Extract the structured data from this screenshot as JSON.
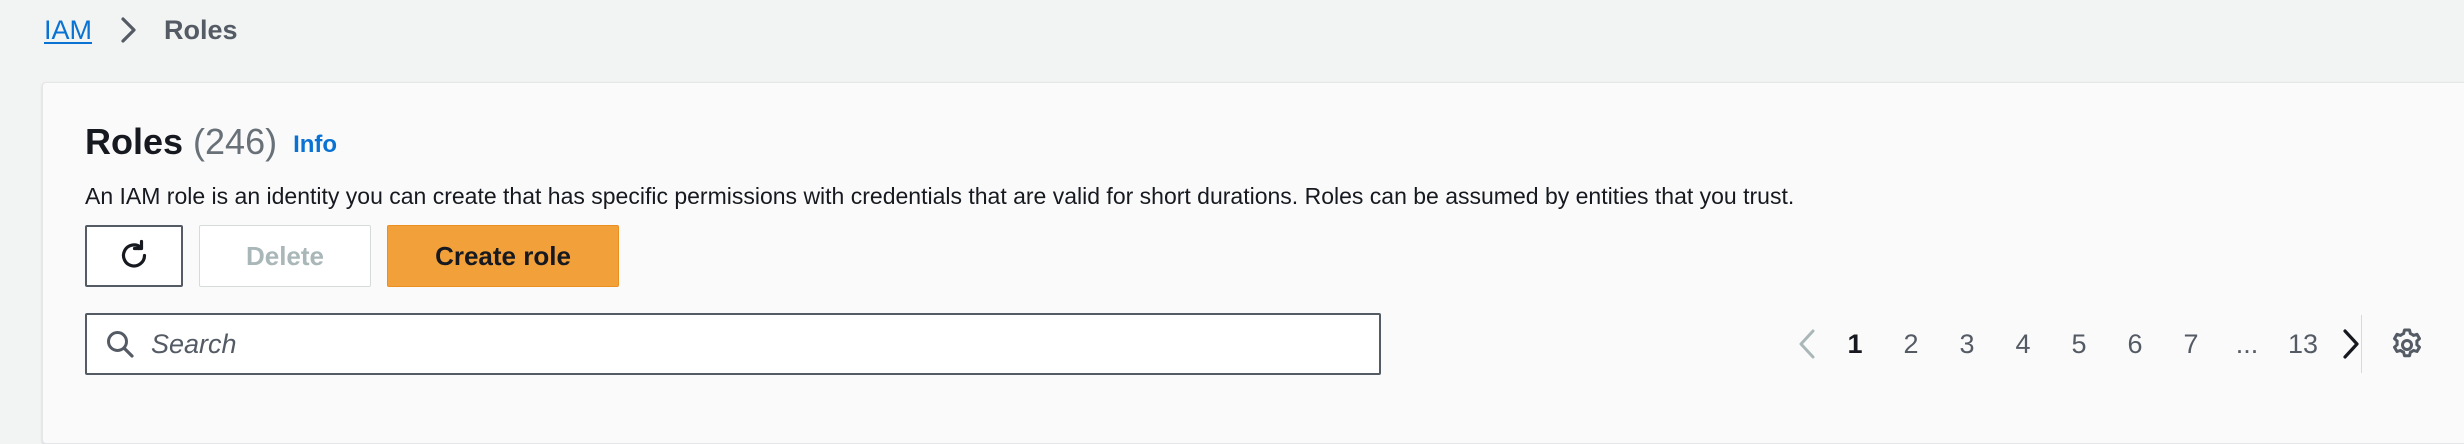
{
  "breadcrumb": {
    "root": "IAM",
    "current": "Roles"
  },
  "panel": {
    "title": "Roles",
    "count": "(246)",
    "info": "Info",
    "description": "An IAM role is an identity you can create that has specific permissions with credentials that are valid for short durations. Roles can be assumed by entities that you trust."
  },
  "actions": {
    "refresh_icon": "refresh-icon",
    "delete_label": "Delete",
    "create_label": "Create role"
  },
  "search": {
    "placeholder": "Search",
    "value": ""
  },
  "pagination": {
    "pages": [
      "1",
      "2",
      "3",
      "4",
      "5",
      "6",
      "7"
    ],
    "ellipsis": "...",
    "last_page": "13",
    "current_page": "1"
  },
  "colors": {
    "accent": "#0972d3",
    "primary_button": "#f2a03a"
  }
}
